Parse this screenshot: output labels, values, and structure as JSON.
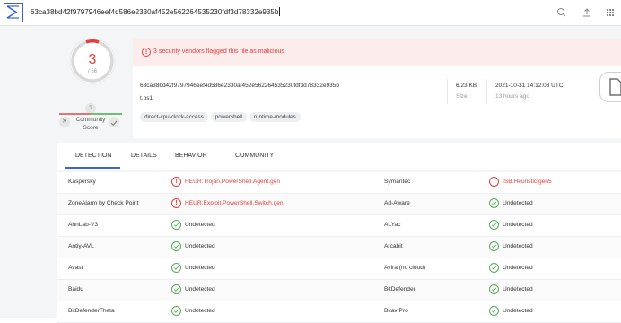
{
  "search": {
    "query": "63ca38bd42f9797946eef4d586e2330af452e562264535230fdf3d78332e935b"
  },
  "icons": {
    "logo": "virustotal-logo-icon",
    "search": "search-icon",
    "upload": "upload-icon",
    "apps": "grid-apps-icon"
  },
  "score": {
    "detections": "3",
    "total": "/ 56",
    "community_unknown": "?",
    "community_label": "Community Score"
  },
  "alert": {
    "text": "3 security vendors flagged this file as malicious"
  },
  "file": {
    "hash": "63ca38bd42f9797946eef4d586e2330af452e562264535230fdf3d78332e935b",
    "name": "t.ps1",
    "tags": [
      "direct-cpu-clock-access",
      "powershell",
      "runtime-modules"
    ],
    "size_value": "6.23 KB",
    "size_label": "Size",
    "date_value": "2021-10-31 14:12:03 UTC",
    "date_label": "13 hours ago"
  },
  "tabs": [
    "DETECTION",
    "DETAILS",
    "BEHAVIOR",
    "COMMUNITY"
  ],
  "colors": {
    "accent": "#3a63d6",
    "malicious": "#e33e3e",
    "clean": "#58a95c"
  },
  "detections": [
    {
      "engine1": "Kaspersky",
      "result1": "HEUR:Trojan.PowerShell.Agent.gen",
      "status1": "malicious",
      "engine2": "Symantec",
      "result2": "ISB.Heuristic!gen5",
      "status2": "malicious"
    },
    {
      "engine1": "ZoneAlarm by Check Point",
      "result1": "HEUR:Exploit.PowerShell.Switch.gen",
      "status1": "malicious",
      "engine2": "Ad-Aware",
      "result2": "Undetected",
      "status2": "undetected"
    },
    {
      "engine1": "AhnLab-V3",
      "result1": "Undetected",
      "status1": "undetected",
      "engine2": "ALYac",
      "result2": "Undetected",
      "status2": "undetected"
    },
    {
      "engine1": "Antiy-AVL",
      "result1": "Undetected",
      "status1": "undetected",
      "engine2": "Arcabit",
      "result2": "Undetected",
      "status2": "undetected"
    },
    {
      "engine1": "Avast",
      "result1": "Undetected",
      "status1": "undetected",
      "engine2": "Avira (no cloud)",
      "result2": "Undetected",
      "status2": "undetected"
    },
    {
      "engine1": "Baidu",
      "result1": "Undetected",
      "status1": "undetected",
      "engine2": "BitDefender",
      "result2": "Undetected",
      "status2": "undetected"
    },
    {
      "engine1": "BitDefenderTheta",
      "result1": "Undetected",
      "status1": "undetected",
      "engine2": "Bkav Pro",
      "result2": "Undetected",
      "status2": "undetected"
    }
  ]
}
